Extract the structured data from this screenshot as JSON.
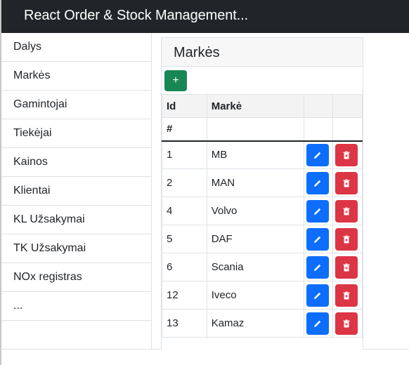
{
  "app": {
    "title": "React Order & Stock Management..."
  },
  "sidebar": {
    "items": [
      {
        "label": "Dalys"
      },
      {
        "label": "Markės"
      },
      {
        "label": "Gamintojai"
      },
      {
        "label": "Tiekėjai"
      },
      {
        "label": "Kainos"
      },
      {
        "label": "Klientai"
      },
      {
        "label": "KL Užsakymai"
      },
      {
        "label": "TK Užsakymai"
      },
      {
        "label": "NOx registras"
      },
      {
        "label": "..."
      }
    ]
  },
  "card": {
    "title": "Markės",
    "add_label": "+",
    "table": {
      "columns": [
        "Id",
        "Markė"
      ],
      "filter_row": [
        "#",
        ""
      ],
      "rows": [
        {
          "id": "1",
          "name": "MB"
        },
        {
          "id": "2",
          "name": "MAN"
        },
        {
          "id": "4",
          "name": "Volvo"
        },
        {
          "id": "5",
          "name": "DAF"
        },
        {
          "id": "6",
          "name": "Scania"
        },
        {
          "id": "12",
          "name": "Iveco"
        },
        {
          "id": "13",
          "name": "Kamaz"
        }
      ]
    }
  },
  "icons": {
    "add": "plus-icon",
    "edit": "pencil-icon",
    "delete": "trash-icon"
  },
  "colors": {
    "navbar": "#212529",
    "add_button": "#198754",
    "edit_button": "#0d6efd",
    "delete_button": "#dc3545"
  }
}
